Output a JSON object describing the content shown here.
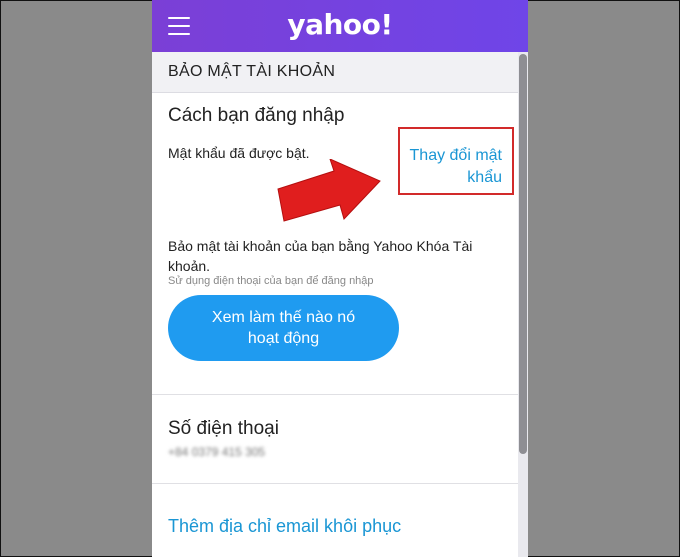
{
  "app": {
    "logo_text": "yahoo!",
    "brand_color": "#7b3fd6"
  },
  "section": {
    "title": "BẢO MẬT TÀI KHOẢN"
  },
  "login": {
    "heading": "Cách bạn đăng nhập",
    "password_status": "Mật khẩu đã được bật.",
    "change_password_label": "Thay đổi mật khẩu",
    "account_key_text": "Bảo mật tài khoản của bạn bằng Yahoo Khóa Tài khoản.",
    "account_key_subtext": "Sử dụng điện thoại của bạn để đăng nhập",
    "how_it_works_button": "Xem làm thế nào nó hoạt động"
  },
  "phone": {
    "heading": "Số điện thoại",
    "number": "+84 0379 415 305"
  },
  "recovery": {
    "add_email_label": "Thêm địa chỉ email khôi phục"
  },
  "annotation": {
    "highlight_color": "#d22a2a",
    "arrow_icon": "red-pointer-arrow"
  }
}
